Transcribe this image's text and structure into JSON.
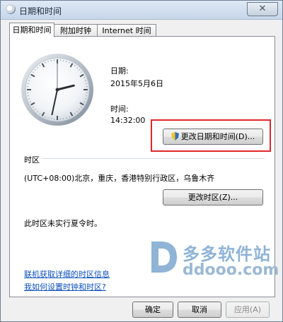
{
  "window": {
    "title": "日期和时间",
    "close_label": "✕"
  },
  "tabs": [
    {
      "label": "日期和时间"
    },
    {
      "label": "附加时钟"
    },
    {
      "label": "Internet 时间"
    }
  ],
  "clock": {
    "hour": 14,
    "minute": 32,
    "second": 0
  },
  "date": {
    "label": "日期:",
    "value": "2015年5月6日"
  },
  "time": {
    "label": "时间:",
    "value": "14:32:00"
  },
  "change_datetime_button": "更改日期和时间(D)...",
  "timezone": {
    "section_label": "时区",
    "value": "(UTC+08:00)北京，重庆，香港特别行政区，乌鲁木齐",
    "change_button": "更改时区(Z)...",
    "dst_note": "此时区未实行夏令时。"
  },
  "links": {
    "online_info": "联机获取详细的时区信息",
    "how_to": "我如何设置时钟和时区?"
  },
  "watermark": {
    "text": "多多软件站",
    "url": "ddooo.com"
  },
  "footer": {
    "ok": "确定",
    "cancel": "取消",
    "apply": "应用(A)"
  }
}
